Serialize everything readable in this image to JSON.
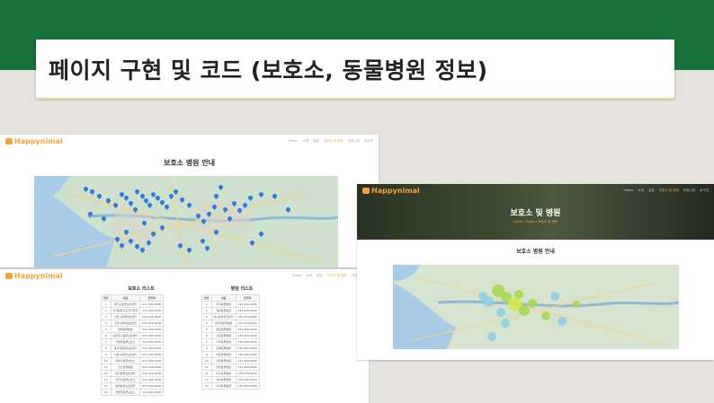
{
  "slide": {
    "title": "페이지 구현 및 코드 (보호소, 동물병원 정보)"
  },
  "brand": "Happynimal",
  "nav_links": [
    "Home",
    "소개",
    "입양",
    "보호소 및 병원",
    "커뮤니티"
  ],
  "nav_right": "로그인",
  "shot_left_top": {
    "heading": "보호소 병원 안내"
  },
  "shot_left_bottom": {
    "shelter_list_title": "보호소 리스트",
    "hospital_list_title": "병원 리스트",
    "shelter_headers": [
      "번호",
      "이름",
      "연락처"
    ],
    "hospital_headers": [
      "번호",
      "이름",
      "연락처"
    ],
    "shelter_rows": [
      [
        "1",
        "경기도동물보호센터",
        "031-000-0000"
      ],
      [
        "2",
        "한국동물구조관리협회",
        "031-000-0000"
      ],
      [
        "3",
        "인천시동물보호센터",
        "032-000-0000"
      ],
      [
        "4",
        "고양시동물보호센터",
        "031-000-0000"
      ],
      [
        "5",
        "위례동물병원",
        "031-000-0000"
      ],
      [
        "6",
        "남양주시동물보호센터",
        "031-000-0000"
      ],
      [
        "7",
        "가평군동물보호소",
        "031-000-0000"
      ],
      [
        "8",
        "동두천동물보호센터",
        "031-000-0000"
      ],
      [
        "9",
        "수원시동물보호센터",
        "031-000-0000"
      ],
      [
        "10",
        "화성시동물보호소",
        "031-000-0000"
      ],
      [
        "11",
        "안산동물병원",
        "031-000-0000"
      ],
      [
        "12",
        "용인동물보호센터",
        "031-000-0000"
      ],
      [
        "13",
        "이천시동물보호소",
        "031-000-0000"
      ],
      [
        "14",
        "평택동물보호센터",
        "031-000-0000"
      ],
      [
        "15",
        "양평군동물보호소",
        "031-000-0000"
      ]
    ],
    "hospital_rows": [
      [
        "1",
        "우리동물병원",
        "031-000-0000"
      ],
      [
        "2",
        "행복동물병원",
        "031-000-0000"
      ],
      [
        "3",
        "하나동물의료센터",
        "031-000-0000"
      ],
      [
        "4",
        "강아지동물병원",
        "031-000-0000"
      ],
      [
        "5",
        "튼튼동물병원",
        "031-000-0000"
      ],
      [
        "6",
        "사랑동물병원",
        "031-000-0000"
      ],
      [
        "7",
        "나비동물병원",
        "031-000-0000"
      ],
      [
        "8",
        "초록동물병원",
        "031-000-0000"
      ],
      [
        "9",
        "바른동물병원",
        "031-000-0000"
      ],
      [
        "10",
        "서울동물병원",
        "031-000-0000"
      ],
      [
        "11",
        "한빛동물병원",
        "031-000-0000"
      ],
      [
        "12",
        "미소동물병원",
        "031-000-0000"
      ],
      [
        "13",
        "365동물병원",
        "031-000-0000"
      ],
      [
        "14",
        "누리동물병원",
        "031-000-0000"
      ]
    ]
  },
  "shot_right": {
    "hero_title": "보호소 및 병원",
    "hero_breadcrumb": "Home / Pages / 보호소 및 병원",
    "heading": "보호소 병원 안내"
  },
  "colors": {
    "green_band": "#16723a",
    "brand_orange": "#f2a33a",
    "pin_blue": "#2d7be5"
  }
}
